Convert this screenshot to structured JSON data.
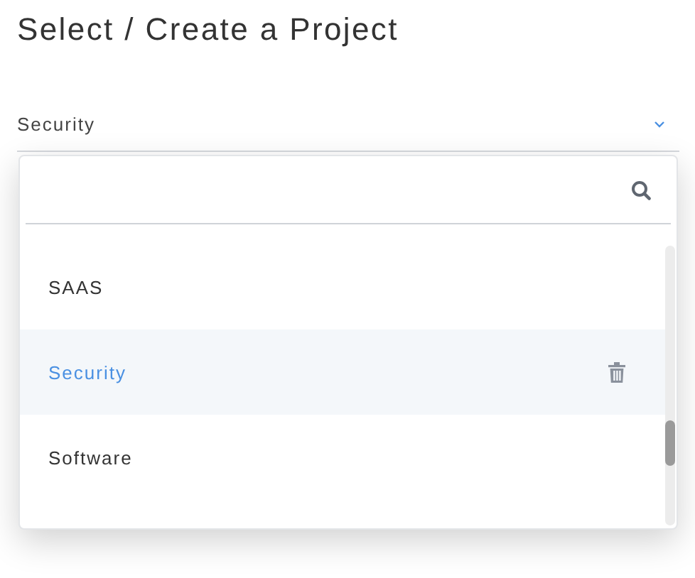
{
  "title": "Select / Create a Project",
  "select": {
    "value": "Security",
    "expanded": true
  },
  "projects": [
    {
      "name": "SAAS",
      "selected": false
    },
    {
      "name": "Security",
      "selected": true
    },
    {
      "name": "Software",
      "selected": false
    }
  ]
}
